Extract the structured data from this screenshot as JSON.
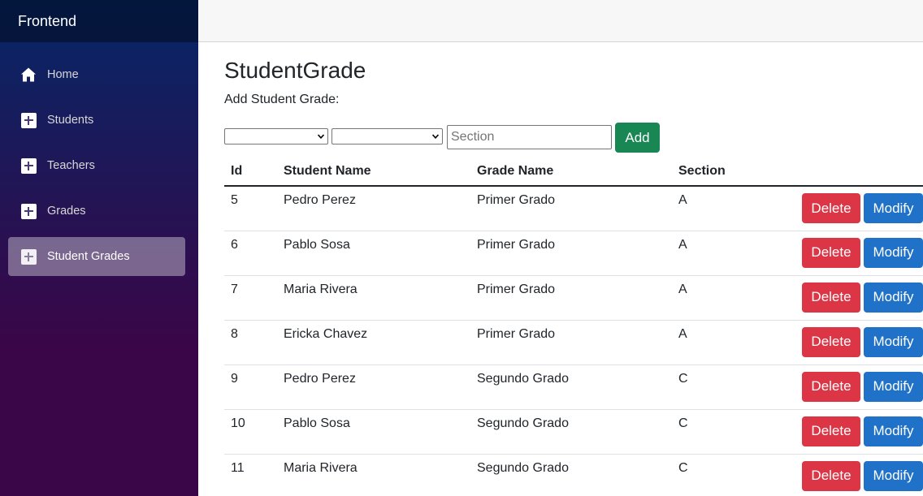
{
  "app": {
    "brand": "Frontend"
  },
  "sidebar": {
    "items": [
      {
        "label": "Home",
        "icon": "home-icon",
        "active": false
      },
      {
        "label": "Students",
        "icon": "plus-square-icon",
        "active": false
      },
      {
        "label": "Teachers",
        "icon": "plus-square-icon",
        "active": false
      },
      {
        "label": "Grades",
        "icon": "plus-square-icon",
        "active": false
      },
      {
        "label": "Student Grades",
        "icon": "plus-square-icon",
        "active": true
      }
    ]
  },
  "page": {
    "title": "StudentGrade",
    "subtitle": "Add Student Grade:"
  },
  "form": {
    "student_select_value": "",
    "grade_select_value": "",
    "section_placeholder": "Section",
    "section_value": "",
    "add_label": "Add"
  },
  "table": {
    "headers": [
      "Id",
      "Student Name",
      "Grade Name",
      "Section",
      ""
    ],
    "rows": [
      {
        "id": "5",
        "student": "Pedro Perez",
        "grade": "Primer Grado",
        "section": "A"
      },
      {
        "id": "6",
        "student": "Pablo Sosa",
        "grade": "Primer Grado",
        "section": "A"
      },
      {
        "id": "7",
        "student": "Maria Rivera",
        "grade": "Primer Grado",
        "section": "A"
      },
      {
        "id": "8",
        "student": "Ericka Chavez",
        "grade": "Primer Grado",
        "section": "A"
      },
      {
        "id": "9",
        "student": "Pedro Perez",
        "grade": "Segundo Grado",
        "section": "C"
      },
      {
        "id": "10",
        "student": "Pablo Sosa",
        "grade": "Segundo Grado",
        "section": "C"
      },
      {
        "id": "11",
        "student": "Maria Rivera",
        "grade": "Segundo Grado",
        "section": "C"
      }
    ],
    "delete_label": "Delete",
    "modify_label": "Modify"
  },
  "colors": {
    "sidebar_top": "#052767",
    "sidebar_bottom": "#3a0647",
    "add_button": "#198754",
    "delete_button": "#dc3545",
    "modify_button": "#1f72c8"
  }
}
